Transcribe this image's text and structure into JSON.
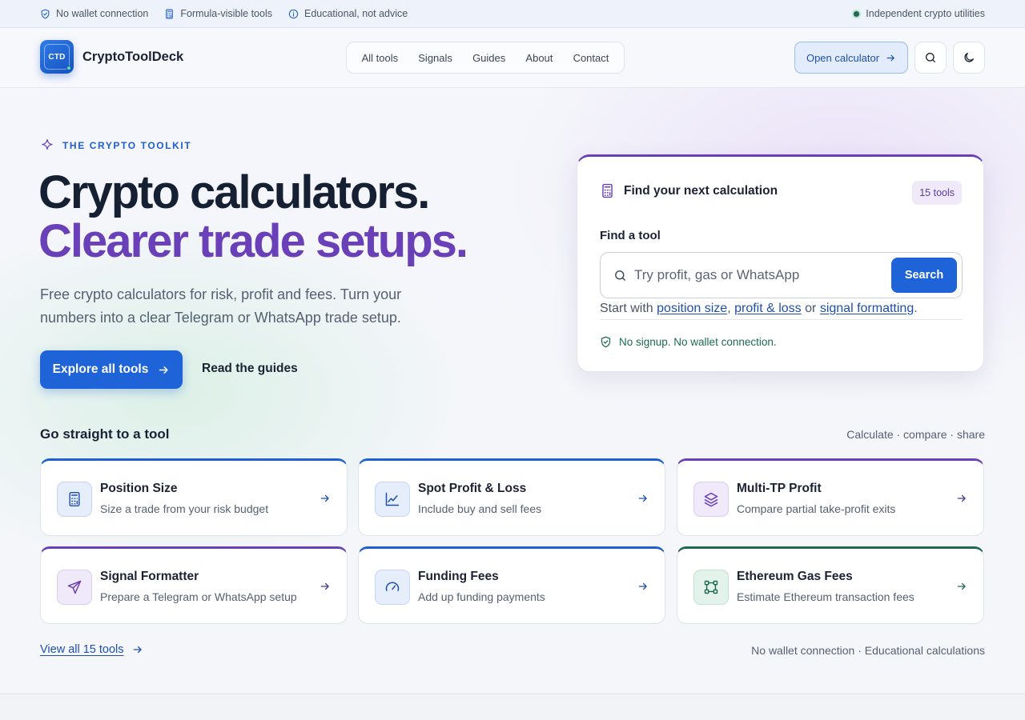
{
  "topstrip": {
    "items": [
      {
        "icon": "shield-check-icon",
        "label": "No wallet connection"
      },
      {
        "icon": "calculator-icon",
        "label": "Formula-visible tools"
      },
      {
        "icon": "info-icon",
        "label": "Educational, not advice"
      }
    ],
    "right_label": "Independent crypto utilities"
  },
  "header": {
    "logo_text": "CTD",
    "brand": "CryptoToolDeck",
    "nav": [
      "All tools",
      "Signals",
      "Guides",
      "About",
      "Contact"
    ],
    "open_calculator": "Open calculator"
  },
  "hero": {
    "eyebrow": "THE CRYPTO TOOLKIT",
    "title_line1": "Crypto calculators.",
    "title_line2": "Clearer trade setups.",
    "subtitle": "Free crypto calculators for risk, profit and fees. Turn your numbers into a clear Telegram or WhatsApp trade setup.",
    "primary_cta": "Explore all tools",
    "secondary_cta": "Read the guides"
  },
  "finder": {
    "title": "Find your next calculation",
    "count_badge": "15 tools",
    "label": "Find a tool",
    "placeholder": "Try profit, gas or WhatsApp",
    "search_button": "Search",
    "hint_prefix": "Start with",
    "hint_link1": "position size",
    "hint_sep1": ",",
    "hint_link2": "profit & loss",
    "hint_or": "or",
    "hint_link3": "signal formatting",
    "hint_end": ".",
    "note": "No signup. No wallet connection."
  },
  "tools": {
    "title": "Go straight to a tool",
    "tagline": "Calculate · compare · share",
    "cards": [
      {
        "name": "Position Size",
        "desc": "Size a trade from your risk budget",
        "icon": "calculator-icon",
        "accent": "#1f5fd1"
      },
      {
        "name": "Spot Profit & Loss",
        "desc": "Include buy and sell fees",
        "icon": "line-chart-icon",
        "accent": "#1f5fd1"
      },
      {
        "name": "Multi-TP Profit",
        "desc": "Compare partial take-profit exits",
        "icon": "layers-icon",
        "accent": "#6a40b8"
      },
      {
        "name": "Signal Formatter",
        "desc": "Prepare a Telegram or WhatsApp setup",
        "icon": "send-icon",
        "accent": "#6a40b8"
      },
      {
        "name": "Funding Fees",
        "desc": "Add up funding payments",
        "icon": "gauge-icon",
        "accent": "#1f5fd1"
      },
      {
        "name": "Ethereum Gas Fees",
        "desc": "Estimate Ethereum transaction fees",
        "icon": "gas-network-icon",
        "accent": "#1d6a52"
      }
    ],
    "view_all": "View all 15 tools",
    "footnote": "No wallet connection · Educational calculations"
  }
}
